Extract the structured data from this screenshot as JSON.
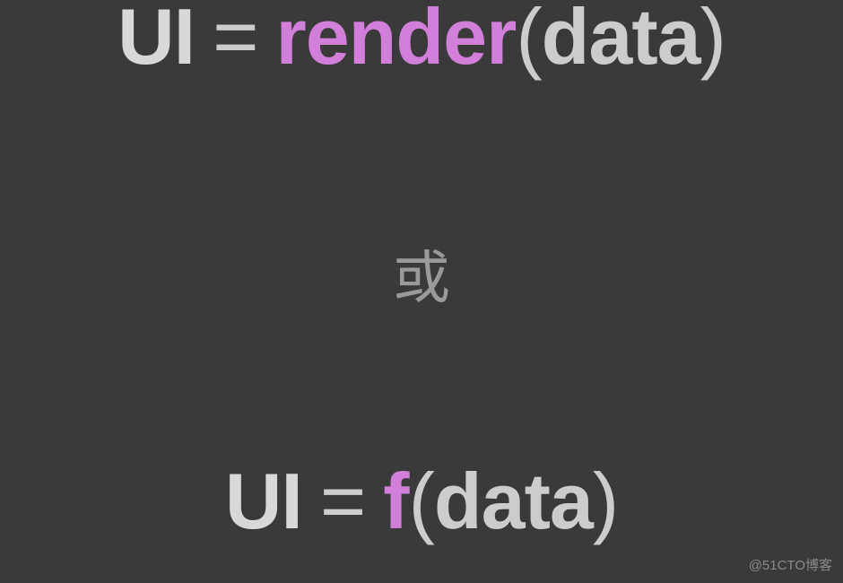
{
  "equation1": {
    "lhs": "UI",
    "eq": "=",
    "fn": "render",
    "paren_open": "(",
    "arg": "data",
    "paren_close": ")"
  },
  "separator": "或",
  "equation2": {
    "lhs": "UI",
    "eq": "=",
    "fn": "f",
    "paren_open": "(",
    "arg": "data",
    "paren_close": ")"
  },
  "watermark": "@51CTO博客"
}
